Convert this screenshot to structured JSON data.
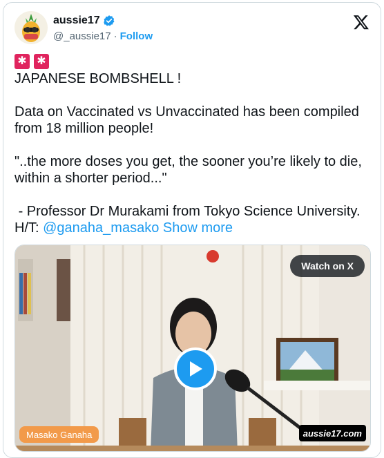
{
  "author": {
    "name": "aussie17",
    "handle": "@_aussie17",
    "separator": "·",
    "follow_label": "Follow"
  },
  "tweet": {
    "siren_icon": "police-car-light-icon",
    "lines": [
      "JAPANESE BOMBSHELL !",
      "Data on Vaccinated vs Unvaccinated has been compiled from 18 million people!",
      "\"..the more doses you get, the sooner you’re likely to die, within a shorter period...\"",
      " - Professor Dr Murakami from Tokyo Science University."
    ],
    "ht_prefix": "H/T: ",
    "mention": "@ganaha_masako",
    "show_more": "Show more"
  },
  "media": {
    "watch_label": "Watch on X",
    "nameplate": "Masako Ganaha",
    "watermark": "aussie17.com"
  },
  "colors": {
    "accent": "#1d9bf0",
    "siren": "#e0245e",
    "nameplate": "#f29a4a"
  }
}
